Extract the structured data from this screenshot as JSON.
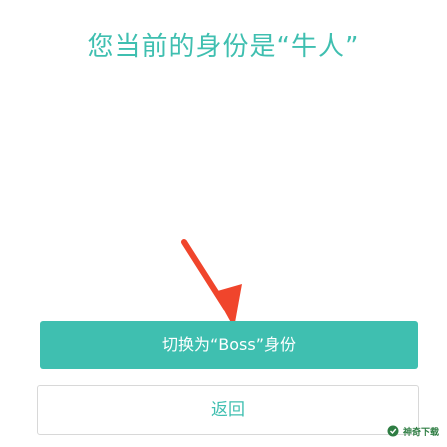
{
  "screen": {
    "title": "您当前的身份是“牛人”"
  },
  "actions": {
    "switch_label": "切换为“Boss”身份",
    "back_label": "返回"
  },
  "annotation": {
    "arrow_color": "#f0452c"
  },
  "watermark": {
    "text": "神奇下载"
  },
  "colors": {
    "accent": "#3fbfb0",
    "background": "#ffffff"
  }
}
